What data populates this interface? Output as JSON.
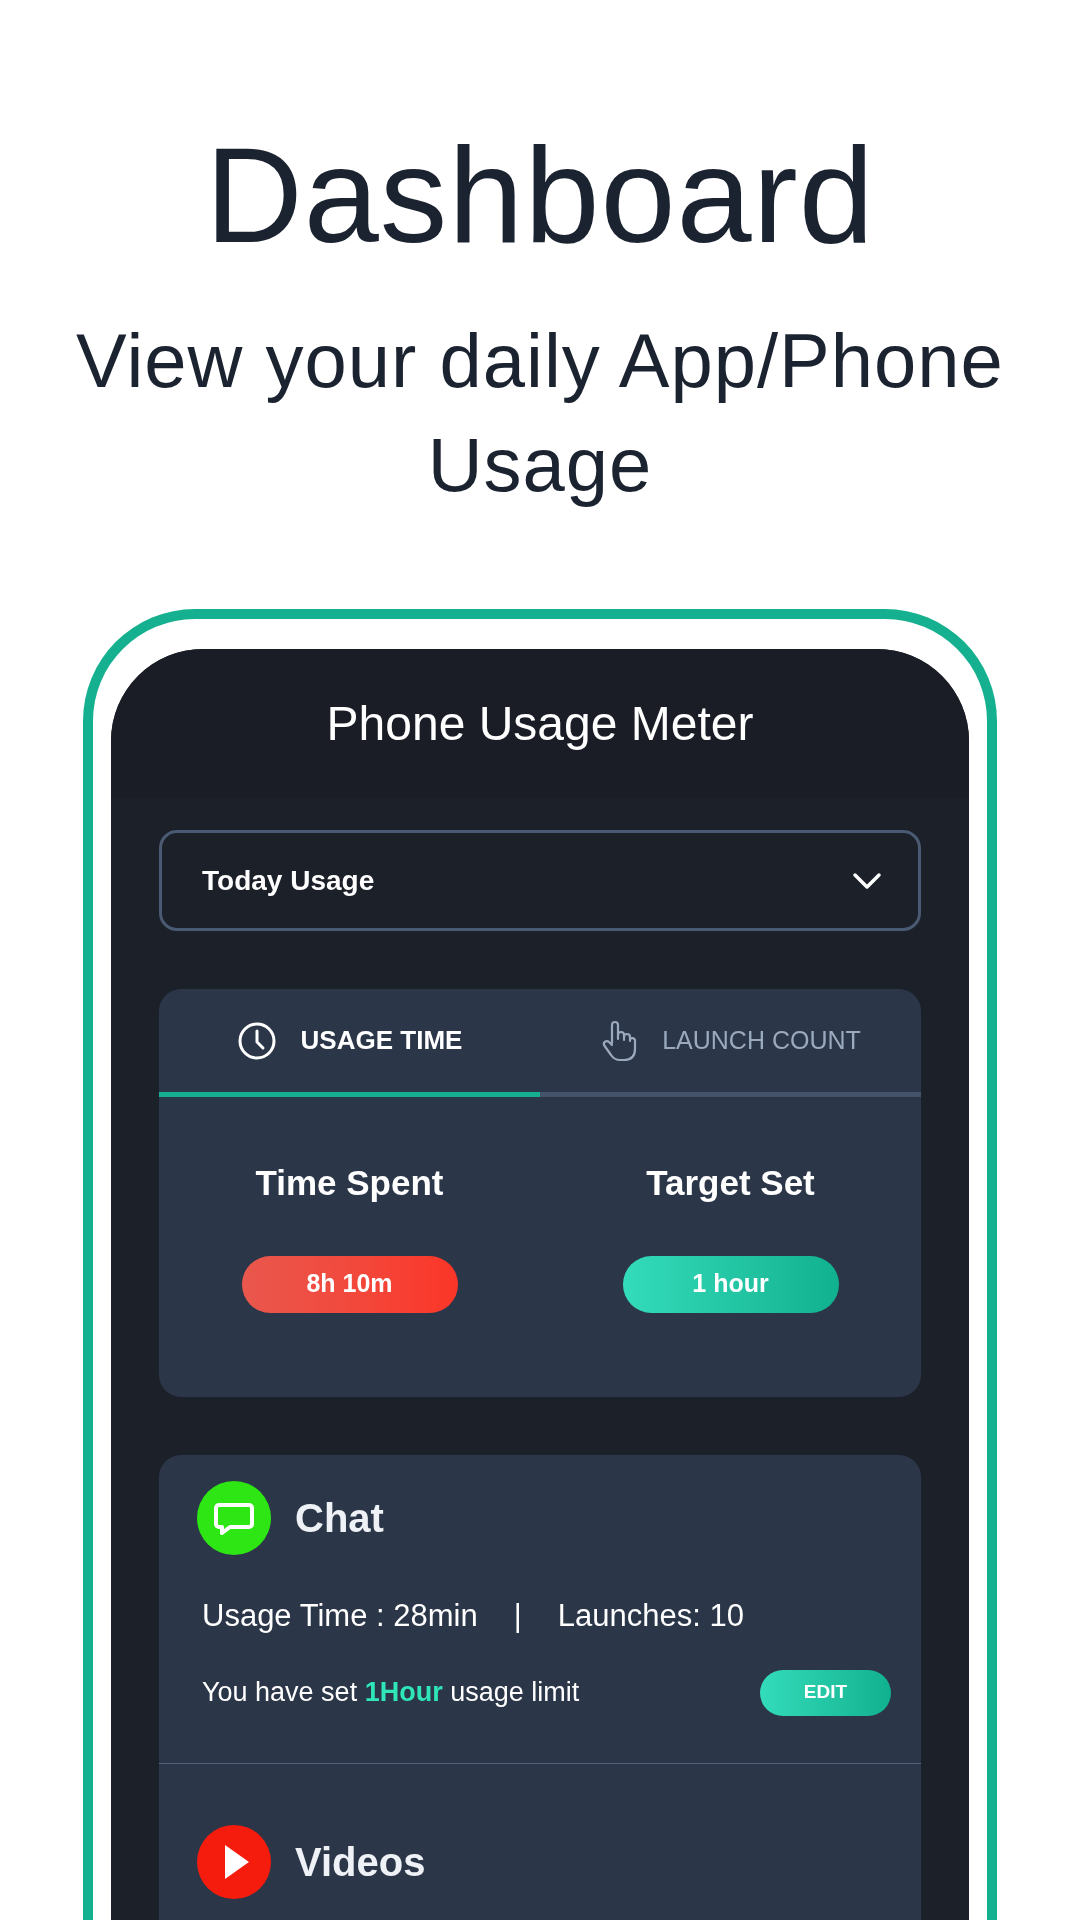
{
  "heading": "Dashboard",
  "subheading": "View your daily App/Phone Usage",
  "app_bar": {
    "title": "Phone Usage Meter"
  },
  "period_dropdown": {
    "value": "Today Usage"
  },
  "tabs": [
    {
      "label": "USAGE TIME",
      "kind": "clock",
      "selected": true
    },
    {
      "label": "LAUNCH COUNT",
      "kind": "hand",
      "selected": false
    }
  ],
  "summary": [
    {
      "label": "Time Spent",
      "value": "8h 10m",
      "kind": "over"
    },
    {
      "label": "Target Set",
      "value": "1 hour",
      "kind": "target"
    }
  ],
  "apps": [
    {
      "name": "Chat",
      "kind": "chat",
      "usage": "Usage Time : 28min",
      "separator": "|",
      "launches": "Launches: 10",
      "limit": "You have set **1Hour** usage limit",
      "button": "EDIT"
    },
    {
      "name": "Videos",
      "kind": "video"
    }
  ]
}
